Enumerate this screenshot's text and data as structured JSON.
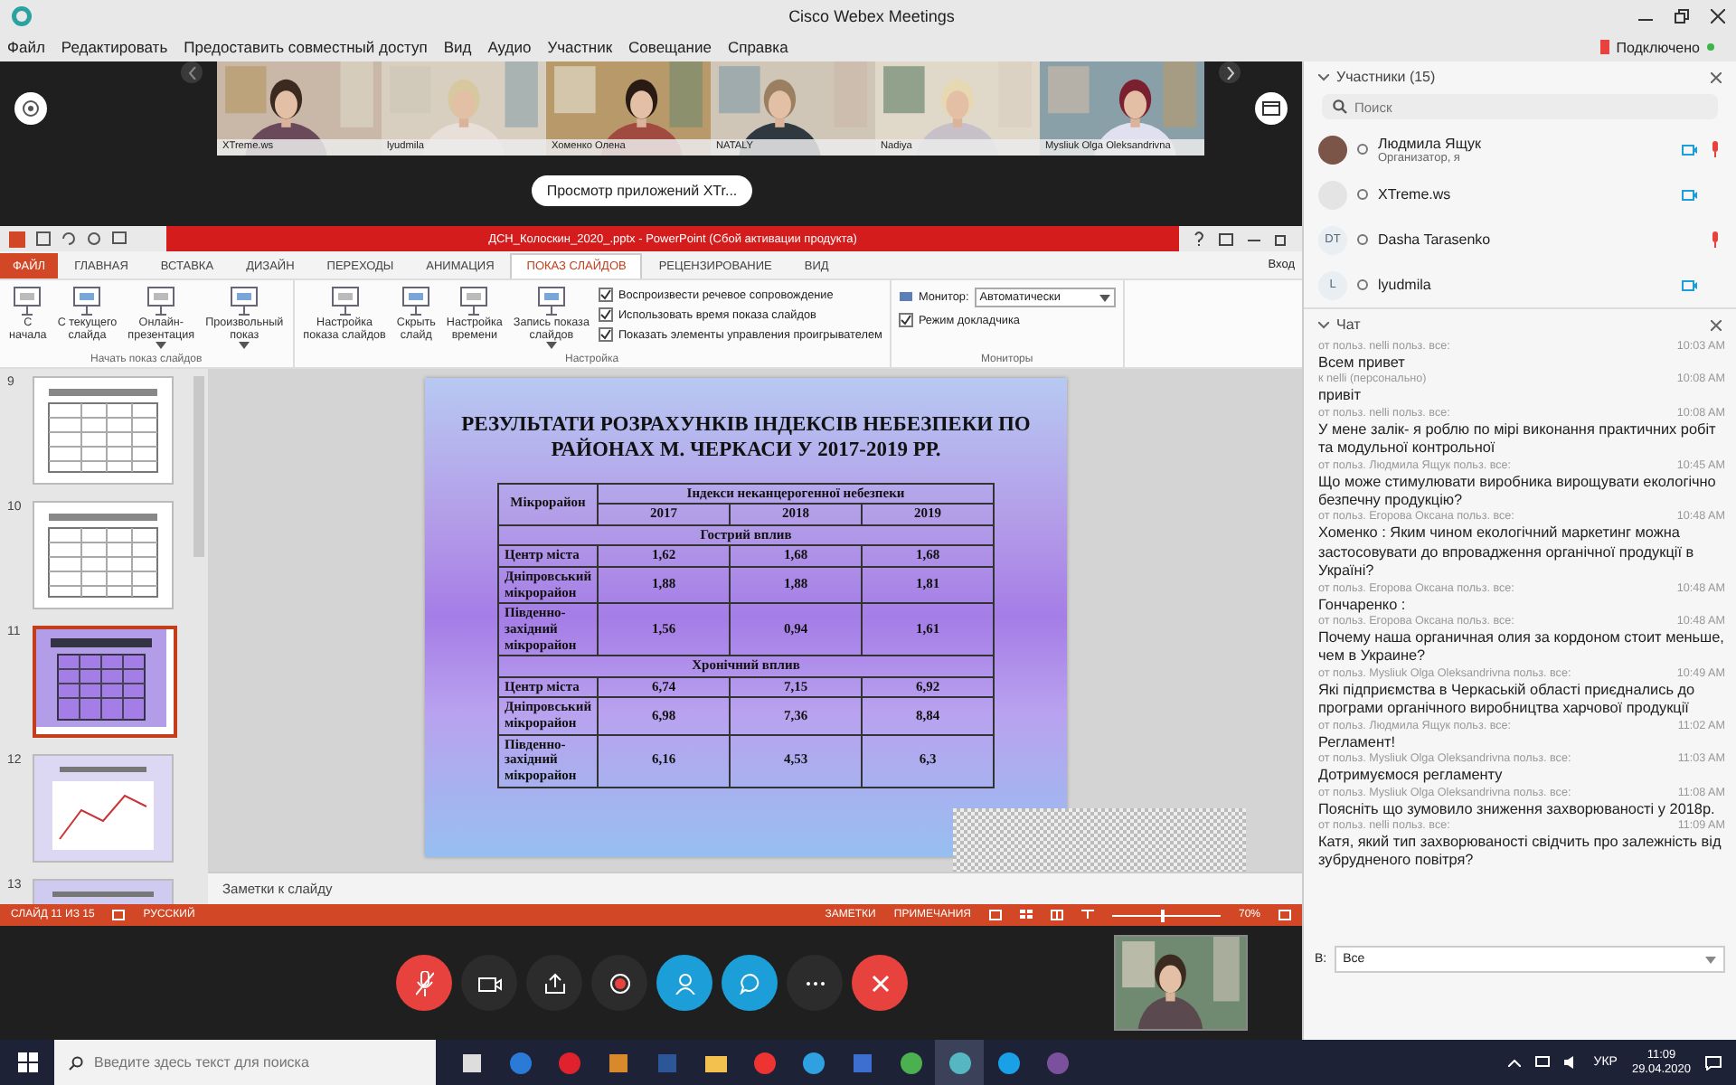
{
  "window": {
    "title": "Cisco Webex Meetings"
  },
  "menu": [
    "Файл",
    "Редактировать",
    "Предоставить совместный доступ",
    "Вид",
    "Аудио",
    "Участник",
    "Совещание",
    "Справка"
  ],
  "connection": "Подключено",
  "video_tiles": [
    {
      "name": "XTreme.ws"
    },
    {
      "name": "lyudmila"
    },
    {
      "name": "Хоменко Олена"
    },
    {
      "name": "NATALY"
    },
    {
      "name": "Nadiya"
    },
    {
      "name": "Mysliuk Olga Oleksandrivna"
    }
  ],
  "share_banner": "Просмотр приложений XTr...",
  "powerpoint": {
    "title": "ДСН_Колоскин_2020_.pptx - PowerPoint (Сбой активации продукта)",
    "tabs": [
      {
        "label": "ФАЙЛ",
        "selected": false,
        "kind": "file"
      },
      {
        "label": "ГЛАВНАЯ",
        "selected": false,
        "kind": "tab"
      },
      {
        "label": "ВСТАВКА",
        "selected": false,
        "kind": "tab"
      },
      {
        "label": "ДИЗАЙН",
        "selected": false,
        "kind": "tab"
      },
      {
        "label": "ПЕРЕХОДЫ",
        "selected": false,
        "kind": "tab"
      },
      {
        "label": "АНИМАЦИЯ",
        "selected": false,
        "kind": "tab"
      },
      {
        "label": "ПОКАЗ СЛАЙДОВ",
        "selected": true,
        "kind": "tab"
      },
      {
        "label": "РЕЦЕНЗИРОВАНИЕ",
        "selected": false,
        "kind": "tab"
      },
      {
        "label": "ВИД",
        "selected": false,
        "kind": "tab"
      }
    ],
    "sign_in": "Вход",
    "ribbon": [
      {
        "label": "Начать показ слайдов",
        "buttons": [
          {
            "lines": [
              "С",
              "начала"
            ],
            "dropdown": false
          },
          {
            "lines": [
              "С текущего",
              "слайда"
            ],
            "dropdown": false
          },
          {
            "lines": [
              "Онлайн-",
              "презентация"
            ],
            "dropdown": true
          },
          {
            "lines": [
              "Произвольный",
              "показ"
            ],
            "dropdown": true
          }
        ]
      },
      {
        "label": "Настройка",
        "buttons": [
          {
            "lines": [
              "Настройка",
              "показа слайдов"
            ],
            "dropdown": false
          },
          {
            "lines": [
              "Скрыть",
              "слайд"
            ],
            "dropdown": false
          },
          {
            "lines": [
              "Настройка",
              "времени"
            ],
            "dropdown": false
          },
          {
            "lines": [
              "Запись показа",
              "слайдов"
            ],
            "dropdown": true
          }
        ],
        "checkboxes": [
          {
            "label": "Воспроизвести речевое сопровождение",
            "checked": true
          },
          {
            "label": "Использовать время показа слайдов",
            "checked": true
          },
          {
            "label": "Показать элементы управления проигрывателем",
            "checked": true
          }
        ]
      },
      {
        "label": "Мониторы",
        "select": {
          "label": "Монитор:",
          "value": "Автоматически"
        },
        "checkboxes": [
          {
            "label": "Режим докладчика",
            "checked": true
          }
        ]
      }
    ],
    "thumbnails": [
      {
        "number": "9",
        "selected": false,
        "kind": "table"
      },
      {
        "number": "10",
        "selected": false,
        "kind": "table"
      },
      {
        "number": "11",
        "selected": true,
        "kind": "colored"
      },
      {
        "number": "12",
        "selected": false,
        "kind": "chart"
      },
      {
        "number": "13",
        "selected": false,
        "kind": "partial"
      }
    ],
    "slide": {
      "title": "РЕЗУЛЬТАТИ РОЗРАХУНКІВ ІНДЕКСІВ НЕБЕЗПЕКИ ПО РАЙОНАХ М. ЧЕРКАСИ У 2017-2019 РР.",
      "table": {
        "corner": "Мікрорайон",
        "group": "Індекси неканцерогенної небезпеки",
        "columns": [
          "2017",
          "2018",
          "2019"
        ],
        "sections": [
          {
            "title": "Гострий вплив",
            "rows": [
              {
                "name": "Центр міста",
                "values": [
                  "1,62",
                  "1,68",
                  "1,68"
                ]
              },
              {
                "name": "Дніпровський мікрорайон",
                "values": [
                  "1,88",
                  "1,88",
                  "1,81"
                ]
              },
              {
                "name": "Південно-західний мікрорайон",
                "values": [
                  "1,56",
                  "0,94",
                  "1,61"
                ]
              }
            ]
          },
          {
            "title": "Хронічний вплив",
            "rows": [
              {
                "name": "Центр міста",
                "values": [
                  "6,74",
                  "7,15",
                  "6,92"
                ]
              },
              {
                "name": "Дніпровський мікрорайон",
                "values": [
                  "6,98",
                  "7,36",
                  "8,84"
                ]
              },
              {
                "name": "Південно-західний мікрорайон",
                "values": [
                  "6,16",
                  "4,53",
                  "6,3"
                ]
              }
            ]
          }
        ]
      }
    },
    "notes_placeholder": "Заметки к слайду",
    "status_bar": {
      "slide": "СЛАЙД 11 ИЗ 15",
      "language": "РУССКИЙ",
      "notes": "ЗАМЕТКИ",
      "comments": "ПРИМЕЧАНИЯ",
      "zoom": "70%",
      "zoom_slider": {
        "level": 0.45
      }
    }
  },
  "controls": [
    {
      "kind": "mute"
    },
    {
      "kind": "video",
      "active": false
    },
    {
      "kind": "share",
      "active": false
    },
    {
      "kind": "record",
      "active": false
    },
    {
      "kind": "participants",
      "active": true
    },
    {
      "kind": "chat",
      "active": true
    },
    {
      "kind": "more",
      "active": false
    },
    {
      "kind": "leave"
    }
  ],
  "participants": {
    "title": "Участники (15)",
    "search": {
      "placeholder": "Поиск"
    },
    "items": [
      {
        "name": "Людмила Ящук",
        "role": "Организатор, я",
        "camera": true,
        "muted": true
      },
      {
        "name": "XTreme.ws",
        "avatar": {
          "kind": "logo"
        },
        "camera": true,
        "muted": false
      },
      {
        "name": "Dasha Tarasenko",
        "avatar": {
          "kind": "initials",
          "text": "DT"
        },
        "camera": false,
        "muted": true
      },
      {
        "name": "lyudmila",
        "avatar": {
          "kind": "initials",
          "text": "L"
        },
        "camera": true,
        "muted": false
      }
    ]
  },
  "chat": {
    "title": "Чат",
    "messages": [
      {
        "from": "от польз. nelli польз. все:",
        "time": "10:03 AM",
        "text": "Всем привет"
      },
      {
        "from": "к nelli (персонально)",
        "time": "10:08 AM",
        "text": "привіт"
      },
      {
        "from": "от польз. nelli польз. все:",
        "time": "10:08 AM",
        "text": "У мене залік- я роблю по мірі виконання практичних робіт та модульної контрольної"
      },
      {
        "from": "от польз. Людмила Ящук польз. все:",
        "time": "10:45 AM",
        "text": "Що може стимулювати  виробника вирощувати екологічно безпечну продукцію?"
      },
      {
        "from": "от польз. Егорова Оксана польз. все:",
        "time": "10:48 AM",
        "text": "Хоменко : Яким чином екологічний маркетинг можна застосовувати до впровадження органічної продукції в Україні?"
      },
      {
        "from": "от польз. Егорова Оксана польз. все:",
        "time": "10:48 AM",
        "text": "Гончаренко :"
      },
      {
        "from": "от польз. Егорова Оксана польз. все:",
        "time": "10:48 AM",
        "text": "Почему наша органичная олия за кордоном стоит меньше, чем в Украине?"
      },
      {
        "from": "от польз. Mysliuk Olga Oleksandrivna польз. все:",
        "time": "10:49 AM",
        "text": "Які підприємства в Черкаській області  приєднались до програми органічного виробництва харчової продукції"
      },
      {
        "from": "от польз. Людмила Ящук польз. все:",
        "time": "11:02 AM",
        "text": "Регламент!"
      },
      {
        "from": "от польз. Mysliuk Olga Oleksandrivna польз. все:",
        "time": "11:03 AM",
        "text": "Дотримуємося регламенту"
      },
      {
        "from": "от польз. Mysliuk Olga Oleksandrivna польз. все:",
        "time": "11:08 AM",
        "text": "Поясніть що зумовило зниження захворюваності у 2018р."
      },
      {
        "from": "от польз. nelli польз. все:",
        "time": "11:09 AM",
        "text": "Катя, який тип захворюваності свідчить про залежність від зубрудненого повітря?"
      }
    ],
    "recipient": {
      "label": "В:",
      "value": "Все"
    }
  },
  "taskbar": {
    "search": {
      "placeholder": "Введите здесь текст для поиска"
    },
    "apps": [
      {
        "kind": "taskview",
        "active": false
      },
      {
        "kind": "edge",
        "active": false
      },
      {
        "kind": "opera",
        "active": false
      },
      {
        "kind": "media",
        "active": false
      },
      {
        "kind": "word",
        "active": false
      },
      {
        "kind": "folder",
        "active": false
      },
      {
        "kind": "yandex",
        "active": false
      },
      {
        "kind": "ie",
        "active": false
      },
      {
        "kind": "disk",
        "active": false
      },
      {
        "kind": "chrome",
        "active": false
      },
      {
        "kind": "webex",
        "active": true
      },
      {
        "kind": "skype",
        "active": false
      },
      {
        "kind": "viber",
        "active": false
      }
    ],
    "language": "УКР",
    "time": "11:09",
    "date": "29.04.2020"
  }
}
